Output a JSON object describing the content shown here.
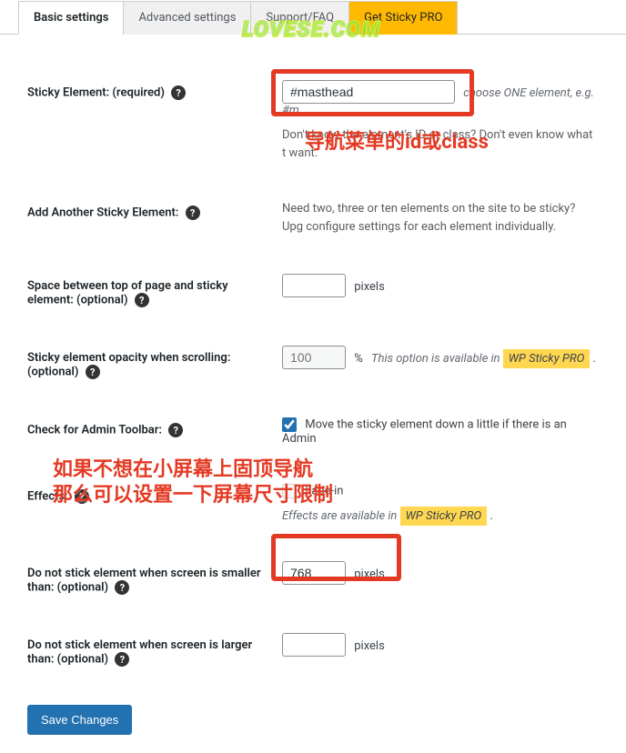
{
  "tabs": {
    "basic": "Basic settings",
    "advanced": "Advanced settings",
    "support": "Support/FAQ",
    "pro": "Get Sticky PRO"
  },
  "watermark": "LOVESE.COM",
  "rows": {
    "sticky_element": {
      "label": "Sticky Element: (required)",
      "value": "#masthead",
      "hint_right": "choose ONE element, e.g. #m",
      "desc": "Don't know the element's ID or class? Don't even know what t want."
    },
    "add_another": {
      "label": "Add Another Sticky Element:",
      "desc": "Need two, three or ten elements on the site to be sticky? Upg configure settings for each element individually."
    },
    "space_top": {
      "label": "Space between top of page and sticky element: (optional)",
      "value": "",
      "unit": "pixels"
    },
    "opacity": {
      "label": "Sticky element opacity when scrolling: (optional)",
      "placeholder": "100",
      "percent": "%",
      "note": "This option is available in",
      "badge": "WP Sticky PRO"
    },
    "admin_toolbar": {
      "label": "Check for Admin Toolbar:",
      "checkbox_label": "Move the sticky element down a little if there is an Admin"
    },
    "effects": {
      "label": "Effects:",
      "fade": "Fade-in",
      "note": "Effects are available in",
      "badge": "WP Sticky PRO"
    },
    "min_screen": {
      "label": "Do not stick element when screen is smaller than: (optional)",
      "value": "768",
      "unit": "pixels"
    },
    "max_screen": {
      "label": "Do not stick element when screen is larger than: (optional)",
      "value": "",
      "unit": "pixels"
    }
  },
  "annotations": {
    "ann1": "导航菜单的id或class",
    "ann2a": "如果不想在小屏幕上固顶导航",
    "ann2b": "那么可以设置一下屏幕尺寸限制"
  },
  "save_button": "Save Changes"
}
